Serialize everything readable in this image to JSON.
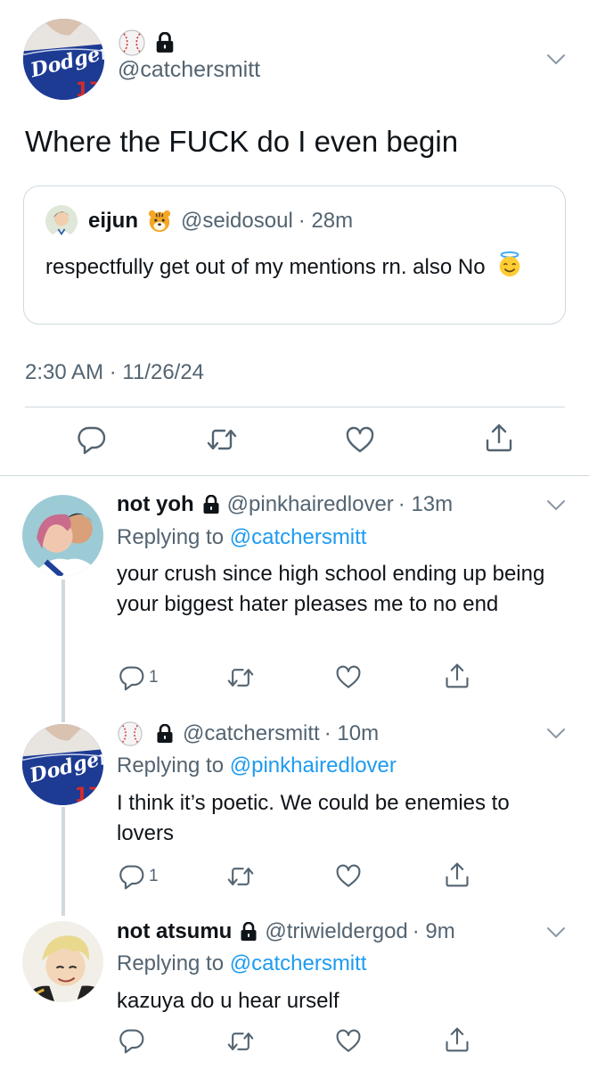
{
  "main_tweet": {
    "handle": "@catchersmitt",
    "text": "Where the FUCK do I even begin",
    "timestamp": "2:30 AM · 11/26/24",
    "quote": {
      "name": "eijun",
      "handle": "@seidosoul",
      "time": "· 28m",
      "text": "respectfully get out of my mentions rn. also No"
    }
  },
  "replies": [
    {
      "name": "not yoh",
      "handle": "@pinkhairedlover",
      "time": "· 13m",
      "replying_label": "Replying to",
      "replying_to": "@catchersmitt",
      "text": "your crush since high school ending up being your biggest hater pleases me to no end",
      "reply_count": "1"
    },
    {
      "name": "",
      "handle": "@catchersmitt",
      "time": "· 10m",
      "replying_label": "Replying to",
      "replying_to": "@pinkhairedlover",
      "text": "I think it’s poetic. We could be enemies to lovers",
      "reply_count": "1"
    },
    {
      "name": "not atsumu",
      "handle": "@triwieldergod",
      "time": "· 9m",
      "replying_label": "Replying to",
      "replying_to": "@catchersmitt",
      "text": "kazuya do u hear urself",
      "reply_count": ""
    }
  ],
  "icons": {
    "reply": "reply-icon",
    "retweet": "retweet-icon",
    "like": "heart-icon",
    "share": "share-icon",
    "more": "chevron-down-icon",
    "lock": "lock-icon",
    "baseball": "baseball-emoji",
    "tiger": "tiger-emoji",
    "halo_face": "smiling-face-with-halo-emoji"
  },
  "colors": {
    "link": "#1d9bf0",
    "secondary_text": "#536471",
    "divider": "#cfd9de"
  }
}
